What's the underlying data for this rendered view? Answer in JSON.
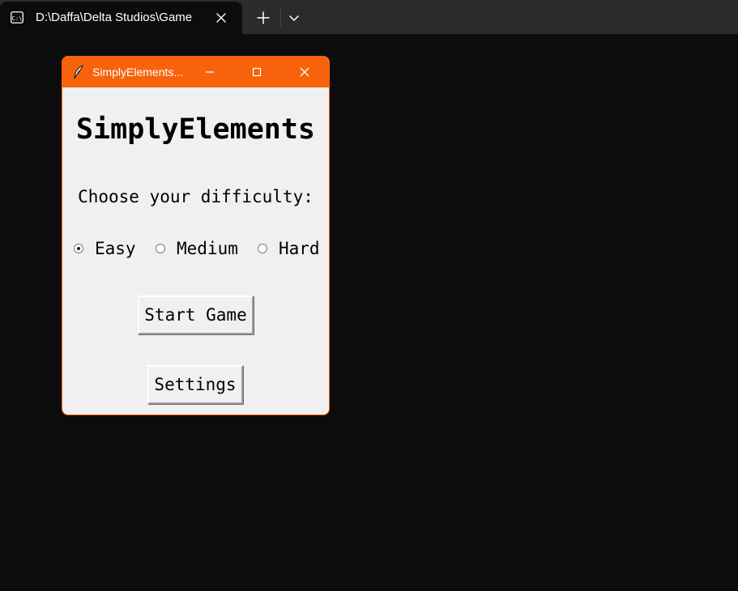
{
  "terminal": {
    "tab_title": "D:\\Daffa\\Delta Studios\\Game",
    "tab_icon": "terminal-icon",
    "new_tab_icon": "plus-icon",
    "dropdown_icon": "chevron-down-icon"
  },
  "window": {
    "title": "SimplyElements...",
    "accent_color": "#f7630c",
    "background_color": "#f0f0f0"
  },
  "app": {
    "heading": "SimplyElements",
    "prompt": "Choose your difficulty:",
    "difficulty_options": [
      {
        "label": "Easy",
        "selected": true
      },
      {
        "label": "Medium",
        "selected": false
      },
      {
        "label": "Hard",
        "selected": false
      }
    ],
    "start_button": "Start Game",
    "settings_button": "Settings"
  }
}
